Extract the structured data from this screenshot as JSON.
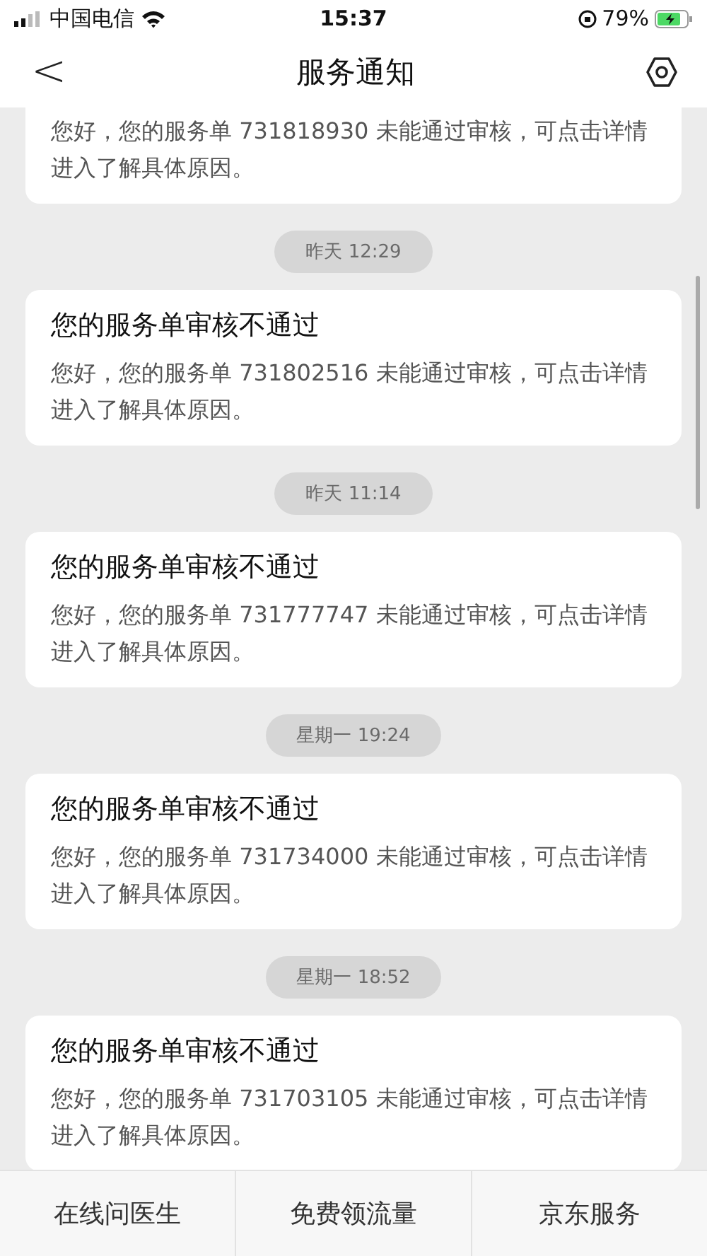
{
  "status_bar": {
    "carrier": "中国电信",
    "time": "15:37",
    "battery": "79%"
  },
  "header": {
    "back": "<",
    "title": "服务通知"
  },
  "messages": [
    {
      "kind": "card",
      "body": "您好，您的服务单 731818930 未能通过审核，可点击详情进入了解具体原因。"
    },
    {
      "kind": "time",
      "time": "昨天 12:29"
    },
    {
      "kind": "card",
      "title": "您的服务单审核不通过",
      "body": "您好，您的服务单 731802516 未能通过审核，可点击详情进入了解具体原因。"
    },
    {
      "kind": "time",
      "time": "昨天 11:14"
    },
    {
      "kind": "card",
      "title": "您的服务单审核不通过",
      "body": "您好，您的服务单 731777747 未能通过审核，可点击详情进入了解具体原因。"
    },
    {
      "kind": "time",
      "time": "星期一 19:24"
    },
    {
      "kind": "card",
      "title": "您的服务单审核不通过",
      "body": "您好，您的服务单 731734000 未能通过审核，可点击详情进入了解具体原因。"
    },
    {
      "kind": "time",
      "time": "星期一 18:52"
    },
    {
      "kind": "card",
      "title": "您的服务单审核不通过",
      "body": "您好，您的服务单 731703105 未能通过审核，可点击详情进入了解具体原因。"
    }
  ],
  "bottom_menu": [
    "在线问医生",
    "免费领流量",
    "京东服务"
  ]
}
